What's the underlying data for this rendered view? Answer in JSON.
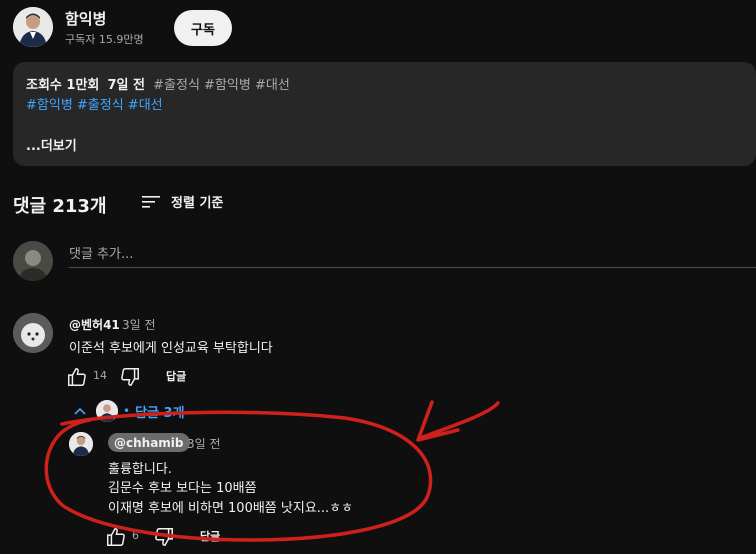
{
  "channel": {
    "name": "함익병",
    "subscribers": "구독자 15.9만명",
    "subscribe_label": "구독"
  },
  "description": {
    "views": "조회수 1만회",
    "age": "7일 전",
    "inline_tags": "#출정식 #함익병 #대선",
    "tags": "#함익병 #출정식 #대선",
    "more_label": "...더보기"
  },
  "comments_header": {
    "count_label": "댓글 213개",
    "sort_label": "정렬 기준",
    "sort_icon": "sort-icon"
  },
  "add_comment": {
    "placeholder": "댓글 추가..."
  },
  "comments": [
    {
      "author": "@벤허41",
      "time": "3일 전",
      "text": "이준석 후보에게 인성교육 부탁합니다",
      "likes": "14",
      "reply_label": "답글",
      "replies_label": "답글 3개"
    }
  ],
  "reply": {
    "author": "@chhamib",
    "time": "3일 전",
    "lines": [
      "훌륭합니다.",
      "김문수 후보 보다는 10배쯤",
      "이재명 후보에 비하면 100배쯤 낫지요...ㅎㅎ"
    ],
    "likes": "6",
    "reply_label": "답글"
  },
  "colors": {
    "background": "#0f0f0f",
    "card": "#272727",
    "link": "#3ea6ff",
    "annotation": "#d0201c"
  }
}
